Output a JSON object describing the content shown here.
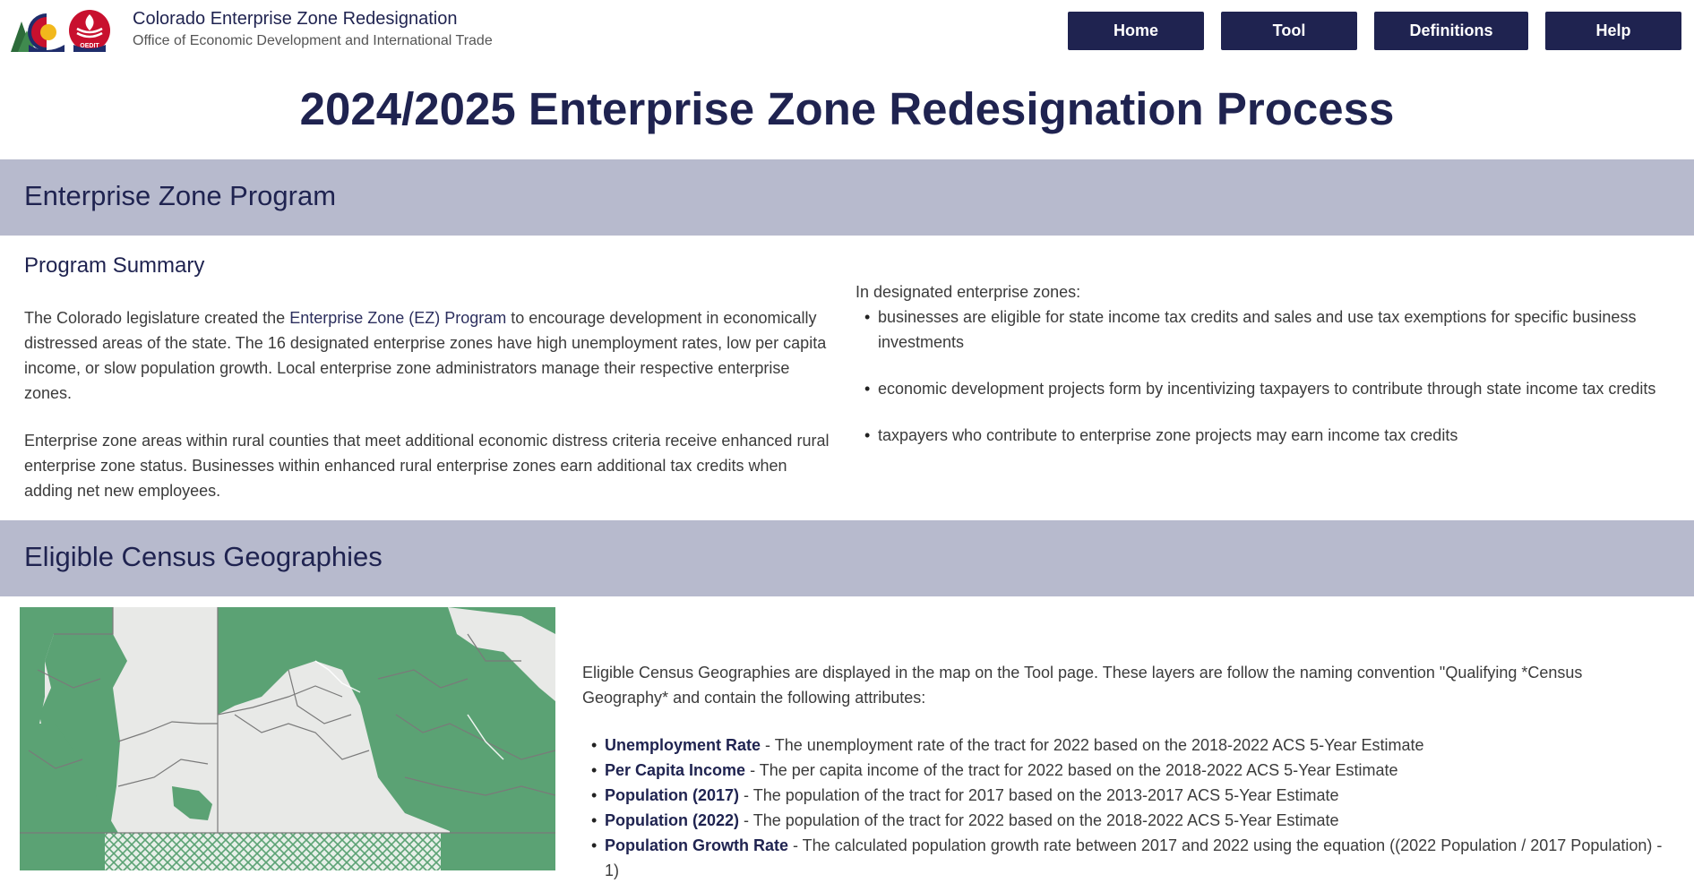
{
  "header": {
    "title": "Colorado Enterprise Zone Redesignation",
    "subtitle": "Office of Economic Development and International Trade",
    "logo_text": "OEDIT",
    "nav": [
      {
        "label": "Home"
      },
      {
        "label": "Tool"
      },
      {
        "label": "Definitions"
      },
      {
        "label": "Help"
      }
    ]
  },
  "page_title": "2024/2025 Enterprise Zone Redesignation Process",
  "program": {
    "heading": "Enterprise Zone Program",
    "summary_heading": "Program Summary",
    "p1_before": "The Colorado legislature created the ",
    "p1_link": "Enterprise Zone (EZ) Program",
    "p1_after": " to encourage development in economically distressed areas of the state. The 16 designated enterprise zones have high unemployment rates, low per capita income, or slow population growth. Local enterprise zone administrators manage their respective enterprise zones.",
    "p2": "Enterprise zone areas within rural counties that meet additional economic distress criteria receive enhanced rural enterprise zone status. Businesses within enhanced rural enterprise zones earn additional tax credits when adding net new employees.",
    "designated_intro": "In designated enterprise zones:",
    "designated_items": [
      "businesses are eligible for state income tax credits and sales and use tax exemptions for specific business investments",
      "economic development projects form by incentivizing taxpayers to contribute through state income tax credits",
      "taxpayers who contribute to enterprise zone projects may earn income tax credits"
    ]
  },
  "census": {
    "heading": "Eligible Census Geographies",
    "intro": "Eligible Census Geographies are displayed in the map on the Tool page. These layers are follow the naming convention \"Qualifying *Census Geography* and contain the following attributes:",
    "attributes": [
      {
        "term": "Unemployment Rate",
        "desc": " - The unemployment rate of the tract for 2022 based on the 2018-2022 ACS 5-Year Estimate"
      },
      {
        "term": "Per Capita Income",
        "desc": " - The per capita income of the tract for 2022 based on the 2018-2022 ACS 5-Year Estimate"
      },
      {
        "term": "Population (2017)",
        "desc": " - The population of the tract for 2017 based on the 2013-2017 ACS 5-Year Estimate"
      },
      {
        "term": "Population (2022)",
        "desc": " - The population of the tract for 2022 based on the 2018-2022 ACS 5-Year Estimate"
      },
      {
        "term": "Population Growth Rate",
        "desc": " - The calculated population growth rate between 2017 and 2022 using the equation ((2022 Population / 2017 Population) - 1)"
      }
    ]
  },
  "colors": {
    "navy": "#1f2350",
    "band": "#b7bacd",
    "map_green": "#5ba274",
    "map_gray": "#e8e9e7"
  }
}
